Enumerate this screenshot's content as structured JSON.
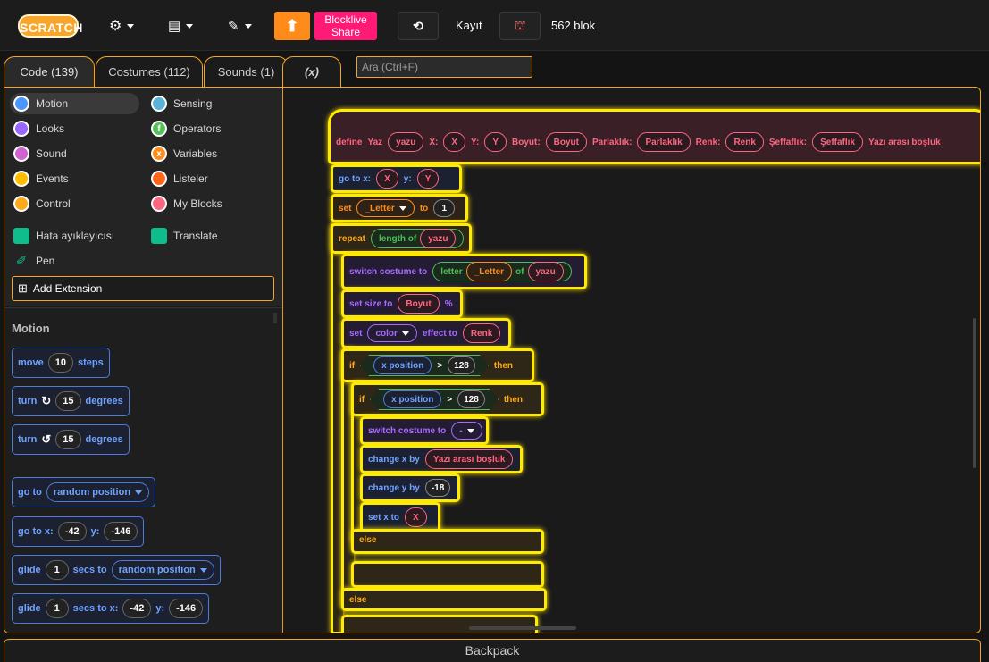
{
  "menubar": {
    "logo": "SCRATCH",
    "upload_icon": "upload-arrow-icon",
    "blocklive_share": "Blocklive Share",
    "kayit": "Kayıt",
    "block_count": "562 blok"
  },
  "tabs": [
    {
      "label": "Code (139)"
    },
    {
      "label": "Costumes (112)"
    },
    {
      "label": "Sounds (1)"
    },
    {
      "label": "(x)"
    }
  ],
  "search": {
    "placeholder": "Ara (Ctrl+F)"
  },
  "categories": {
    "motion": "Motion",
    "sensing": "Sensing",
    "looks": "Looks",
    "operators": "Operators",
    "sound": "Sound",
    "variables": "Variables",
    "events": "Events",
    "listeler": "Listeler",
    "control": "Control",
    "myblocks": "My Blocks",
    "debugger": "Hata ayıklayıcısı",
    "translate": "Translate",
    "pen": "Pen",
    "add_extension": "Add Extension"
  },
  "palette": {
    "title": "Motion",
    "move": {
      "a": "move",
      "v": "10",
      "b": "steps"
    },
    "turn_right": {
      "a": "turn",
      "v": "15",
      "b": "degrees"
    },
    "turn_left": {
      "a": "turn",
      "v": "15",
      "b": "degrees"
    },
    "goto_random": {
      "a": "go to",
      "v": "random position"
    },
    "goto_xy": {
      "a": "go to x:",
      "x": "-42",
      "b": "y:",
      "y": "-146"
    },
    "glide_random": {
      "a": "glide",
      "v": "1",
      "b": "secs to",
      "t": "random position"
    },
    "glide_xy": {
      "a": "glide",
      "v": "1",
      "b": "secs to x:",
      "x": "-42",
      "c": "y:",
      "y": "-146"
    }
  },
  "script": {
    "define": {
      "label": "define",
      "name": "Yaz",
      "p1": "yazu",
      "l2": "X:",
      "p2": "X",
      "l3": "Y:",
      "p3": "Y",
      "l4": "Boyut:",
      "p4": "Boyut",
      "l5": "Parlaklık:",
      "p5": "Parlaklık",
      "l6": "Renk:",
      "p6": "Renk",
      "l7": "Şeffaflık:",
      "p7": "Şeffaflık",
      "l8": "Yazı arası boşluk"
    },
    "goto": {
      "a": "go to x:",
      "x": "X",
      "b": "y:",
      "y": "Y"
    },
    "set_var": {
      "a": "set",
      "var": "_Letter",
      "b": "to",
      "v": "1"
    },
    "repeat": {
      "a": "repeat",
      "op": "length of",
      "arg": "yazu"
    },
    "switch_costume": {
      "a": "switch costume to",
      "op": "letter",
      "arg1": "_Letter",
      "of": "of",
      "arg2": "yazu"
    },
    "set_size": {
      "a": "set size to",
      "arg": "Boyut",
      "b": "%"
    },
    "set_effect": {
      "a": "set",
      "effect": "color",
      "b": "effect to",
      "arg": "Renk"
    },
    "if1": {
      "a": "if",
      "rep": "x position",
      "op": ">",
      "v": "128",
      "b": "then"
    },
    "if2": {
      "a": "if",
      "rep": "x position",
      "op": ">",
      "v": "128",
      "b": "then"
    },
    "switch_costume2": {
      "a": "switch costume to",
      "v": "-"
    },
    "change_x": {
      "a": "change x by",
      "arg": "Yazı arası boşluk"
    },
    "change_y": {
      "a": "change y by",
      "v": "-18"
    },
    "set_x": {
      "a": "set x to",
      "arg": "X"
    },
    "else1": "else",
    "else2": "else"
  },
  "backpack": "Backpack"
}
